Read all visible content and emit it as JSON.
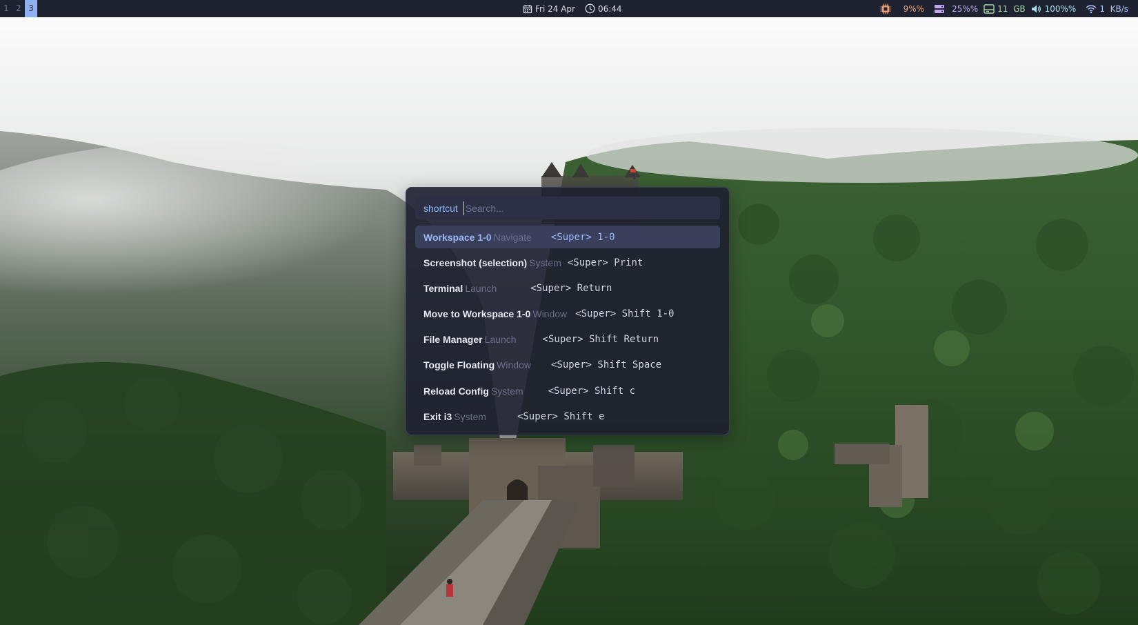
{
  "workspaces": [
    {
      "label": "1",
      "active": false
    },
    {
      "label": "2",
      "active": false
    },
    {
      "label": "3",
      "active": true
    }
  ],
  "clock": {
    "date": "Fri 24 Apr",
    "time": "06:44"
  },
  "status": {
    "cpu": "9%%",
    "memory": "25%%",
    "disk": "11  GB",
    "volume": "100%%",
    "network": "1  KB/s"
  },
  "launcher": {
    "prompt": "shortcut",
    "search_placeholder": "Search...",
    "search_value": "",
    "rows": [
      {
        "name": "Workspace 1-0",
        "category": "Navigate",
        "keys": "<Super> 1-0",
        "selected": true
      },
      {
        "name": "Screenshot (selection)",
        "category": "System",
        "keys": "<Super> Print",
        "selected": false
      },
      {
        "name": "Terminal",
        "category": "Launch",
        "keys": "<Super> Return",
        "selected": false
      },
      {
        "name": "Move to Workspace 1-0",
        "category": "Window",
        "keys": "<Super> Shift 1-0",
        "selected": false
      },
      {
        "name": "File Manager",
        "category": "Launch",
        "keys": "<Super> Shift Return",
        "selected": false
      },
      {
        "name": "Toggle Floating",
        "category": "Window",
        "keys": "<Super> Shift Space",
        "selected": false
      },
      {
        "name": "Reload Config",
        "category": "System",
        "keys": "<Super> Shift c",
        "selected": false
      },
      {
        "name": "Exit i3",
        "category": "System",
        "keys": "<Super> Shift e",
        "selected": false
      }
    ]
  },
  "icons": {
    "calendar": "calendar-icon",
    "clock": "clock-icon",
    "cpu": "cpu-icon",
    "memory": "memory-icon",
    "disk": "disk-icon",
    "volume": "volume-icon",
    "wifi": "wifi-icon"
  },
  "colors": {
    "bar_bg": "#1f2230",
    "active_workspace": "#8fb0f0",
    "launcher_bg": "#1e1f30",
    "accent": "#9ab8f8"
  }
}
